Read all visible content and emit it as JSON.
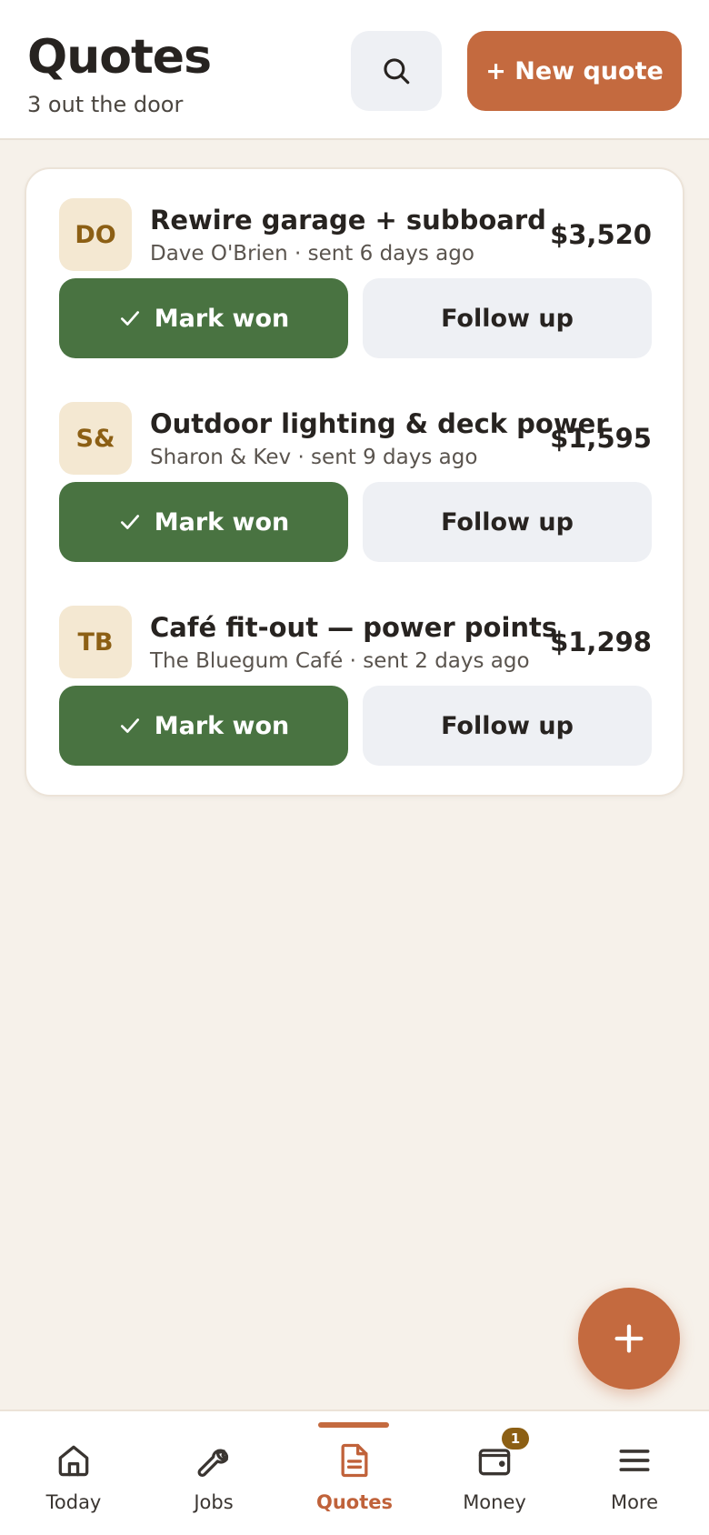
{
  "header": {
    "title": "Quotes",
    "subtitle": "3 out the door",
    "search_icon": "search-icon",
    "new_quote_label": "+ New quote"
  },
  "quotes": [
    {
      "initials": "DO",
      "title": "Rewire garage + subboard",
      "meta": "Dave O'Brien · sent 6 days ago",
      "amount": "$3,520",
      "won_label": "Mark won",
      "follow_label": "Follow up"
    },
    {
      "initials": "S&",
      "title": "Outdoor lighting & deck power",
      "meta": "Sharon & Kev · sent 9 days ago",
      "amount": "$1,595",
      "won_label": "Mark won",
      "follow_label": "Follow up"
    },
    {
      "initials": "TB",
      "title": "Café fit-out — power points",
      "meta": "The Bluegum Café · sent 2 days ago",
      "amount": "$1,298",
      "won_label": "Mark won",
      "follow_label": "Follow up"
    }
  ],
  "fab": {
    "icon": "plus-icon"
  },
  "nav": {
    "items": [
      {
        "label": "Today",
        "icon": "home-icon"
      },
      {
        "label": "Jobs",
        "icon": "wrench-icon"
      },
      {
        "label": "Quotes",
        "icon": "document-icon",
        "active": true
      },
      {
        "label": "Money",
        "icon": "wallet-icon",
        "badge": "1"
      },
      {
        "label": "More",
        "icon": "menu-icon"
      }
    ]
  },
  "colors": {
    "accent": "#c46a3f",
    "success": "#497341",
    "background": "#f6f1ea",
    "avatar_bg": "#f4e8d2",
    "avatar_text": "#8c5f14"
  }
}
